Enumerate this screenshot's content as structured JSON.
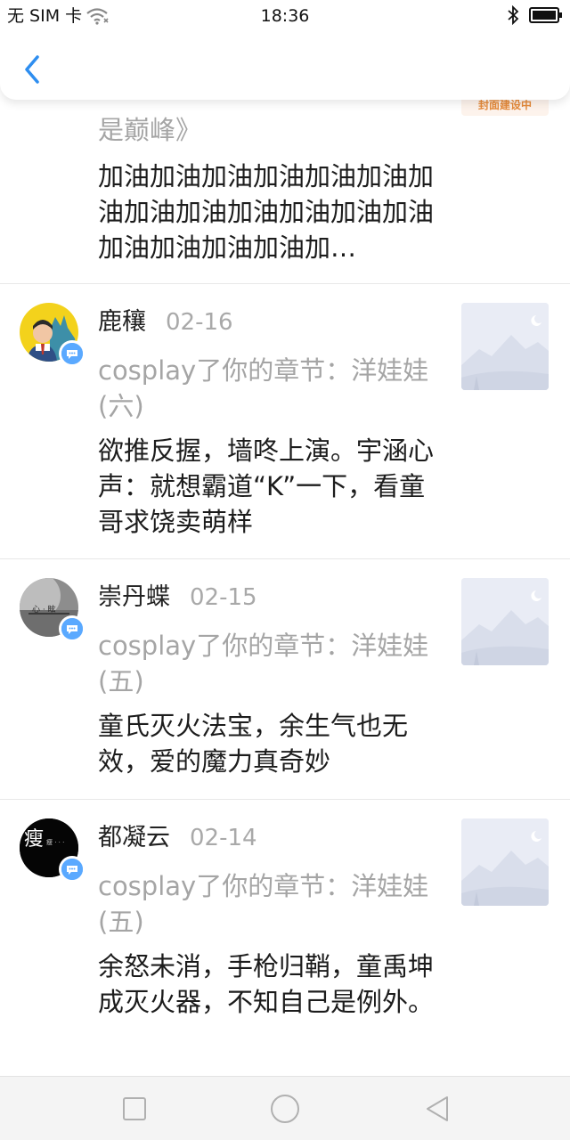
{
  "status_bar": {
    "carrier": "无 SIM 卡",
    "time": "18:36"
  },
  "partial_item": {
    "action_tail": "是巅峰》",
    "comment": "加油加油加油加油加油加油加油加油加油加油加油加油加油加油加油加油加油加…",
    "thumb_label": "封面建设中"
  },
  "items": [
    {
      "name": "鹿穰",
      "date": "02-16",
      "action": "cosplay了你的章节：洋娃娃(六)",
      "comment": "欲推反握，墙咚上演。宇涵心声：就想霸道“K”一下，看童哥求饶卖萌样"
    },
    {
      "name": "崇丹蝶",
      "date": "02-15",
      "action": "cosplay了你的章节：洋娃娃(五)",
      "comment": "童氏灭火法宝，余生气也无效，爱的魔力真奇妙"
    },
    {
      "name": "都凝云",
      "date": "02-14",
      "action": "cosplay了你的章节：洋娃娃(五)",
      "comment": "余怒未消，手枪归鞘，童禹坤成灭火器，不知自己是例外。",
      "avatar_text": "瘦"
    }
  ],
  "icons": {
    "back": "chevron-left-icon",
    "nav_recent": "square-icon",
    "nav_home": "circle-icon",
    "nav_back": "triangle-back-icon"
  },
  "colors": {
    "accent": "#2e8ef0",
    "badge": "#5aa9ff",
    "muted_text": "#a5a5a5"
  }
}
